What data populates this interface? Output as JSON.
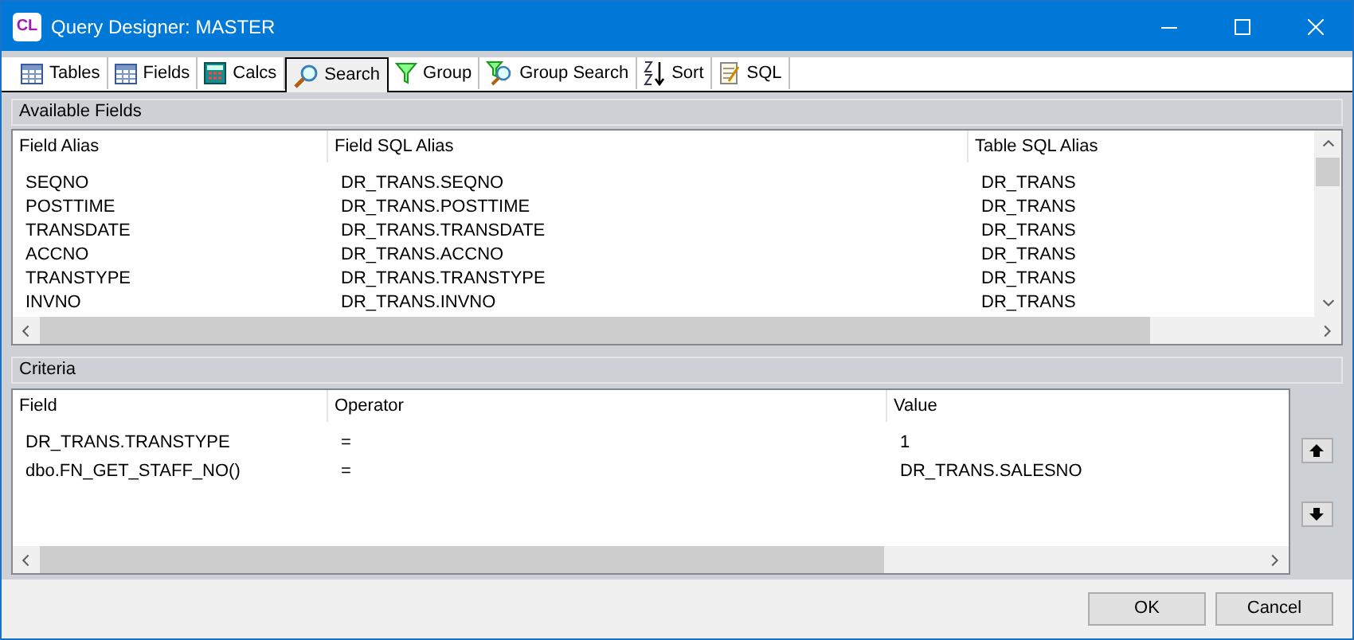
{
  "window": {
    "logo": "CL",
    "title": "Query Designer: MASTER"
  },
  "tabs": [
    {
      "label": "Tables",
      "kind": "table",
      "selected": false
    },
    {
      "label": "Fields",
      "kind": "table",
      "selected": false
    },
    {
      "label": "Calcs",
      "kind": "calc",
      "selected": false
    },
    {
      "label": "Search",
      "kind": "search",
      "selected": true
    },
    {
      "label": "Group",
      "kind": "filter",
      "selected": false
    },
    {
      "label": "Group Search",
      "kind": "filtersearch",
      "selected": false
    },
    {
      "label": "Sort",
      "kind": "sort",
      "selected": false
    },
    {
      "label": "SQL",
      "kind": "sql",
      "selected": false
    }
  ],
  "available_fields": {
    "title": "Available Fields",
    "columns": [
      "Field Alias",
      "Field SQL Alias",
      "Table SQL Alias"
    ],
    "rows": [
      [
        "SEQNO",
        "DR_TRANS.SEQNO",
        "DR_TRANS"
      ],
      [
        "POSTTIME",
        "DR_TRANS.POSTTIME",
        "DR_TRANS"
      ],
      [
        "TRANSDATE",
        "DR_TRANS.TRANSDATE",
        "DR_TRANS"
      ],
      [
        "ACCNO",
        "DR_TRANS.ACCNO",
        "DR_TRANS"
      ],
      [
        "TRANSTYPE",
        "DR_TRANS.TRANSTYPE",
        "DR_TRANS"
      ],
      [
        "INVNO",
        "DR_TRANS.INVNO",
        "DR_TRANS"
      ]
    ]
  },
  "criteria": {
    "title": "Criteria",
    "columns": [
      "Field",
      "Operator",
      "Value"
    ],
    "rows": [
      [
        "DR_TRANS.TRANSTYPE",
        "=",
        "1"
      ],
      [
        "dbo.FN_GET_STAFF_NO()",
        "=",
        "DR_TRANS.SALESNO"
      ]
    ]
  },
  "buttons": [
    "OK",
    "Cancel"
  ]
}
